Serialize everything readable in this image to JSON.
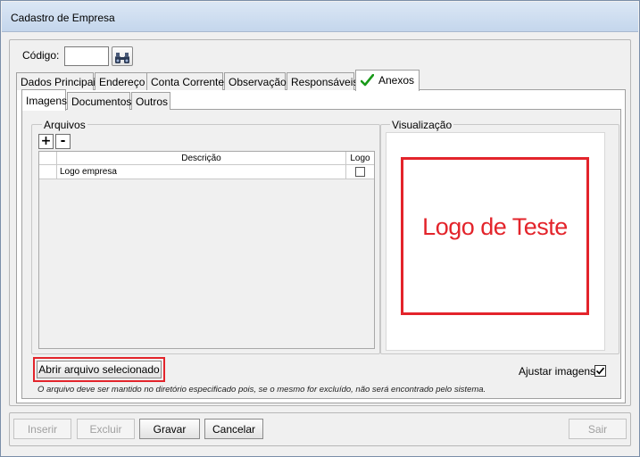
{
  "window": {
    "title": "Cadastro de Empresa"
  },
  "header": {
    "codigo_label": "Código:",
    "codigo_value": ""
  },
  "tabs": {
    "main": [
      "Dados Principais",
      "Endereço",
      "Conta Corrente",
      "Observação",
      "Responsáveis",
      "Anexos"
    ],
    "active_main": "Anexos",
    "sub": [
      "Imagens",
      "Documentos",
      "Outros"
    ],
    "active_sub": "Imagens"
  },
  "files": {
    "group_label": "Arquivos",
    "add_label": "+",
    "remove_label": "-",
    "columns": {
      "descricao": "Descrição",
      "logo": "Logo"
    },
    "rows": [
      {
        "descricao": "Logo empresa",
        "logo": false
      }
    ]
  },
  "preview": {
    "group_label": "Visualização",
    "image_text": "Logo de Teste",
    "image_border_color": "#e3242b"
  },
  "actions": {
    "open_file": "Abrir arquivo selecionado",
    "adjust_images": "Ajustar imagens",
    "adjust_images_checked": true,
    "hint": "O arquivo deve ser mantido no diretório especificado pois, se o mesmo for excluído, não será encontrado pelo sistema."
  },
  "footer": {
    "inserir": "Inserir",
    "excluir": "Excluir",
    "gravar": "Gravar",
    "cancelar": "Cancelar",
    "sair": "Sair"
  },
  "colors": {
    "highlight": "#e3242b",
    "check_green": "#1a9a1a"
  }
}
